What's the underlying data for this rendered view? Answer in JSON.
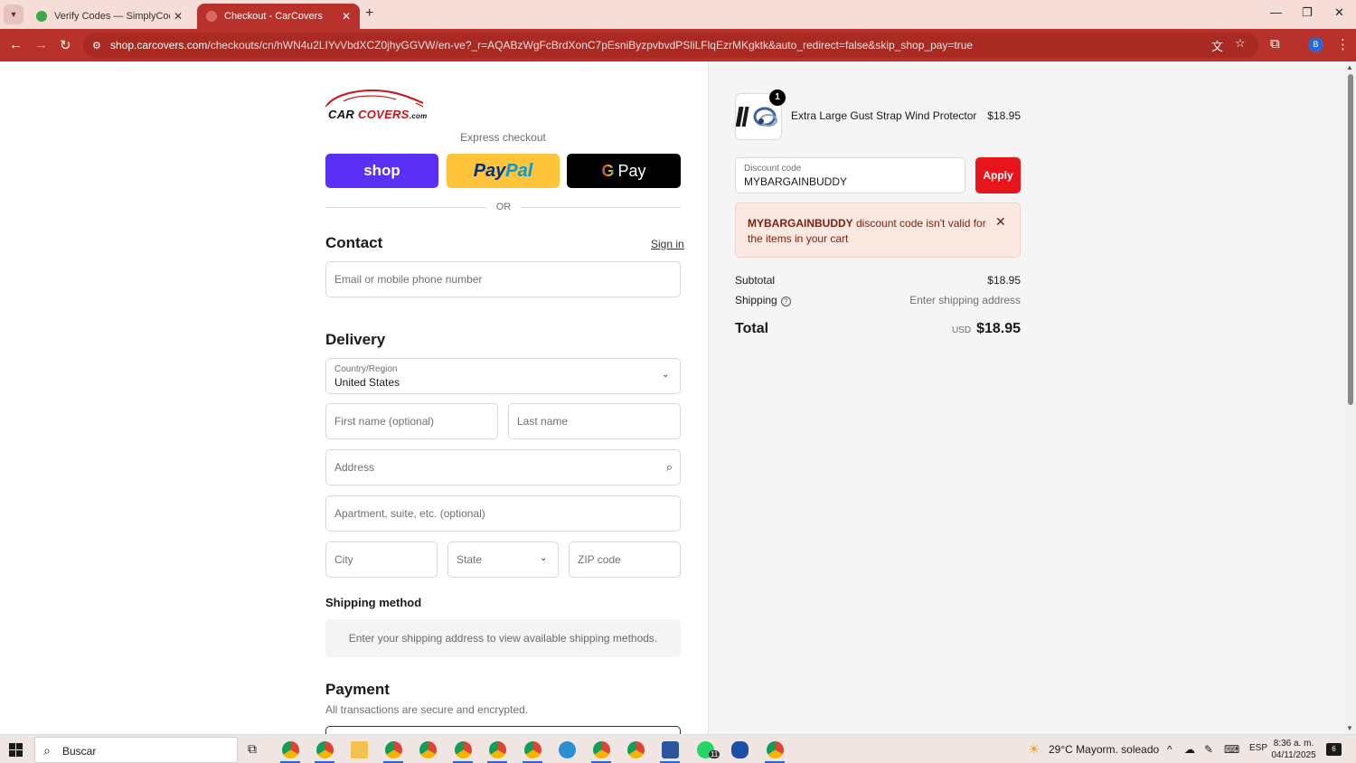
{
  "browser": {
    "tabs": [
      {
        "label": "Verify Codes — SimplyCodes",
        "active": false
      },
      {
        "label": "Checkout - CarCovers",
        "active": true
      }
    ],
    "url_host": "shop.carcovers.com",
    "url_path": "/checkouts/cn/hWN4u2LIYvVbdXCZ0jhyGGVW/en-ve?_r=AQABzWgFcBrdXonC7pEsniByzpvbvdPSliLFlqEzrMKgktk&auto_redirect=false&skip_shop_pay=true",
    "profile_initial": "B",
    "accent": "#b8312a"
  },
  "logo": {
    "brand_a": "CAR",
    "brand_b": "COVERS",
    "suffix": ".com"
  },
  "express": {
    "title": "Express checkout",
    "shop_label": "shop",
    "paypal_a": "Pay",
    "paypal_b": "Pal",
    "gpay_g": "G",
    "gpay_label": "Pay",
    "or": "OR"
  },
  "contact": {
    "title": "Contact",
    "sign_in": "Sign in",
    "email_placeholder": "Email or mobile phone number"
  },
  "delivery": {
    "title": "Delivery",
    "country_label": "Country/Region",
    "country_value": "United States",
    "first_name_placeholder": "First name (optional)",
    "last_name_placeholder": "Last name",
    "address_placeholder": "Address",
    "apartment_placeholder": "Apartment, suite, etc. (optional)",
    "city_placeholder": "City",
    "state_placeholder": "State",
    "zip_placeholder": "ZIP code"
  },
  "shipping_method": {
    "title": "Shipping method",
    "message": "Enter your shipping address to view available shipping methods."
  },
  "payment": {
    "title": "Payment",
    "subtitle": "All transactions are secure and encrypted."
  },
  "summary": {
    "product": {
      "quantity": "1",
      "name": "Extra Large Gust Strap Wind Protector",
      "price": "$18.95"
    },
    "discount": {
      "label": "Discount code",
      "value": "MYBARGAINBUDDY",
      "apply_label": "Apply"
    },
    "alert": {
      "code": "MYBARGAINBUDDY",
      "message": " discount code isn't valid for the items in your cart"
    },
    "subtotal_label": "Subtotal",
    "subtotal_value": "$18.95",
    "shipping_label": "Shipping",
    "shipping_value": "Enter shipping address",
    "total_label": "Total",
    "total_currency": "USD",
    "total_value": "$18.95",
    "apply_color": "#e8141c"
  },
  "taskbar": {
    "search_label": "Buscar",
    "weather": "29°C  Mayorm. soleado",
    "lang": "ESP",
    "time": "8:36 a. m.",
    "date": "04/11/2025",
    "notif_count": "6",
    "whatsapp_badge": "11"
  }
}
